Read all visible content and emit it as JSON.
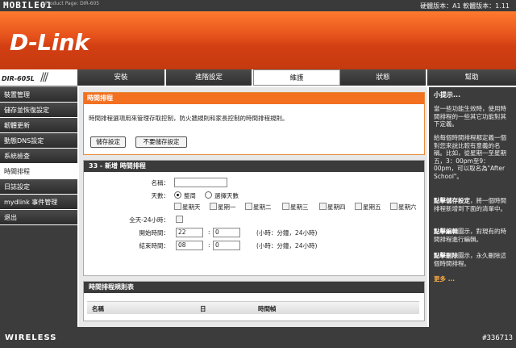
{
  "topbar": {
    "watermark": "MOBILE01",
    "product_tag": "Product Page: DIR-605",
    "hw_version": "硬體版本：A1   軟體版本：1.11"
  },
  "header": {
    "brand": "D-Link"
  },
  "model": {
    "label": "DIR-605L"
  },
  "tabs": [
    {
      "label": "安裝",
      "width": 110
    },
    {
      "label": "進階設定",
      "width": 108
    },
    {
      "label": "維護",
      "width": 108
    },
    {
      "label": "狀態",
      "width": 108
    },
    {
      "label": "幫助",
      "width": 110
    }
  ],
  "sidebar": {
    "items": [
      "裝置管理",
      "儲存並恢復設定",
      "韌體更新",
      "動態DNS設定",
      "系統檢查",
      "時間排程",
      "日誌設定",
      "mydlink 事件管理",
      "退出"
    ]
  },
  "intro": {
    "title": "時間排程",
    "text": "時間排程選項用來管理存取控制，防火牆規則和家長控制的時間排程規則。",
    "save_label": "儲存設定",
    "nosave_label": "不要儲存設定"
  },
  "add": {
    "title": "33 - 新增 時間排程",
    "name_label": "名稱：",
    "name_value": "",
    "days_label": "天數：",
    "all_week": "整周",
    "select_days": "選擇天數",
    "days": [
      "星期天",
      "星期一",
      "星期二",
      "星期三",
      "星期四",
      "星期五",
      "星期六"
    ],
    "allday_label": "全天-24小時：",
    "start_label": "開始時間：",
    "end_label": "結束時間：",
    "start_hour": "22",
    "start_min": "0",
    "end_hour": "08",
    "end_min": "0",
    "time_hint": "(小時：分鐘，24小時)"
  },
  "rules": {
    "title": "時間排程規則表",
    "col_name": "名稱",
    "col_day": "日",
    "col_frame": "時間幀"
  },
  "help": {
    "title": "小提示...",
    "p1": "當一些功能生效時，使用時間排程的一些其它功能對其下定義。",
    "p2": "給每個時間排程都定義一個對您來說比較有意義的名稱。比如，從星期一至星期五，3：00pm至9：00pm，可以取名為\"After School\"。",
    "p3_bold": "點擊儲存設定",
    "p3": "，將一個時間排程新增到下面的清單中。",
    "p4_bold": "點擊編輯",
    "p4": "圖示，對現有的時間排程進行編輯。",
    "p5_bold": "點擊刪除",
    "p5": "圖示，永久刪除這個時間排程。",
    "more": "更多 ..."
  },
  "footer": {
    "wireless": "WIRELESS",
    "post_id": "#336713"
  }
}
